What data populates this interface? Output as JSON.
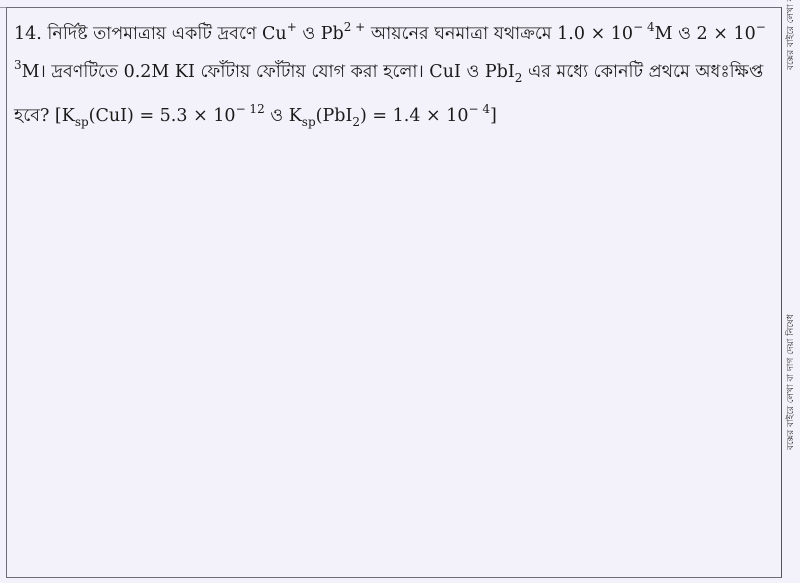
{
  "question": {
    "number": "14.",
    "t1": "নির্দিষ্ট তাপমাত্রায় একটি দ্রবণে Cu",
    "s1": "+",
    "t2": " ও Pb",
    "s2": "2 +",
    "t3": " আয়নের ঘনমাত্রা যথাক্রমে 1.0 × 10",
    "s3": "− 4",
    "t4": "M ও 2 × 10",
    "s4": "− 3",
    "t5": "M। দ্রবণটিতে 0.2M KI ফোঁটায় ফোঁটায় যোগ করা হলো। CuI ও PbI",
    "b1": "2",
    "t6": " এর মধ্যে কোনটি প্রথমে অধঃক্ষিপ্ত হবে? [K",
    "b2": "sp",
    "t7": "(CuI) = 5.3 × 10",
    "s5": "− 12",
    "t8": " ও K",
    "b3": "sp",
    "t9": "(PbI",
    "b4": "2",
    "t10": ") = 1.4 × 10",
    "s6": "− 4",
    "t11": "]"
  },
  "margin_note": "বক্সের বাইরে লেখা বা দাগ দেয়া নিষেধ",
  "margin_note_top": "বক্সের বাইরে লেখা ব"
}
